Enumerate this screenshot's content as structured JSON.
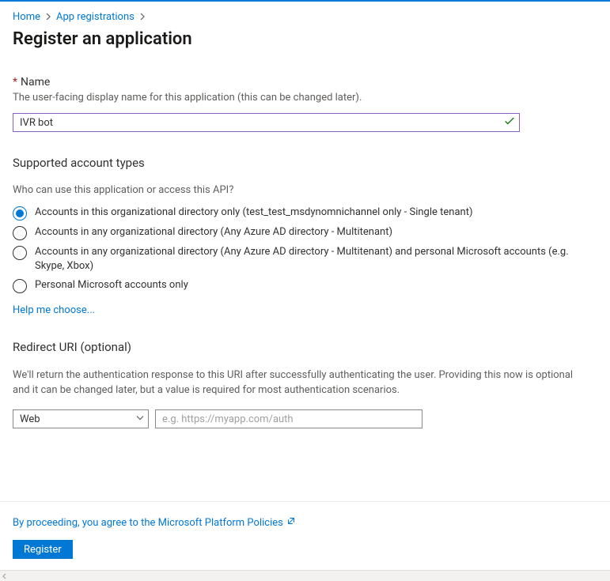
{
  "breadcrumb": {
    "items": [
      "Home",
      "App registrations"
    ]
  },
  "page_title": "Register an application",
  "name": {
    "label": "Name",
    "required_marker": "*",
    "description": "The user-facing display name for this application (this can be changed later).",
    "value": "IVR bot"
  },
  "account_types": {
    "heading": "Supported account types",
    "subquestion": "Who can use this application or access this API?",
    "options": [
      "Accounts in this organizational directory only (test_test_msdynomnichannel only - Single tenant)",
      "Accounts in any organizational directory (Any Azure AD directory - Multitenant)",
      "Accounts in any organizational directory (Any Azure AD directory - Multitenant) and personal Microsoft accounts (e.g. Skype, Xbox)",
      "Personal Microsoft accounts only"
    ],
    "selected_index": 0,
    "help_link": "Help me choose..."
  },
  "redirect_uri": {
    "heading": "Redirect URI (optional)",
    "description": "We'll return the authentication response to this URI after successfully authenticating the user. Providing this now is optional and it can be changed later, but a value is required for most authentication scenarios.",
    "platform_selected": "Web",
    "uri_placeholder": "e.g. https://myapp.com/auth",
    "uri_value": ""
  },
  "footer": {
    "policies_text": "By proceeding, you agree to the Microsoft Platform Policies",
    "register_label": "Register"
  }
}
